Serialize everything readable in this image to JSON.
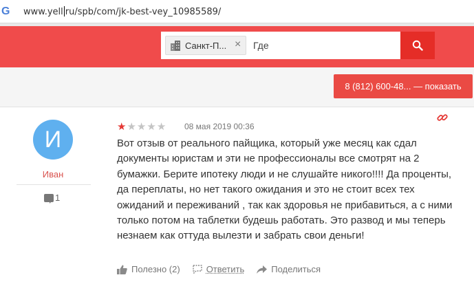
{
  "browser": {
    "url_before_caret": "www.yell",
    "url_after_caret": "ru/spb/com/jk-best-vey_10985589/",
    "engine_icon_letter": "G"
  },
  "header": {
    "city_chip_label": "Санкт-П...",
    "city_chip_close": "×",
    "where_placeholder": "Где",
    "brand_color": "#f04b4b"
  },
  "phone_button_label": "8 (812) 600-48... — показать",
  "review": {
    "avatar_letter": "И",
    "author_name": "Иван",
    "comment_count": "1",
    "rating": 1,
    "rating_max": 5,
    "date": "08 мая 2019 00:36",
    "text": "Вот отзыв от реального пайщика, который уже месяц как сдал документы юристам и эти не профессионалы все смотрят на 2 бумажки. Берите ипотеку люди и не слушайте никого!!!! Да проценты, да переплаты, но нет такого ожидания и это не стоит всех тех ожиданий и переживаний , так как здоровья не прибавиться, а с ними только потом на таблетки будешь работать. Это развод и мы теперь незнаем как оттуда вылезти и забрать свои деньги!",
    "actions": {
      "useful_label": "Полезно (2)",
      "reply_label": "Ответить",
      "share_label": "Поделиться"
    }
  },
  "icons": {
    "city": "building-icon",
    "search": "search-icon",
    "link": "link-icon",
    "comment": "comment-icon",
    "thumbs_up": "thumbs-up-icon",
    "reply": "reply-icon",
    "share": "share-icon"
  }
}
